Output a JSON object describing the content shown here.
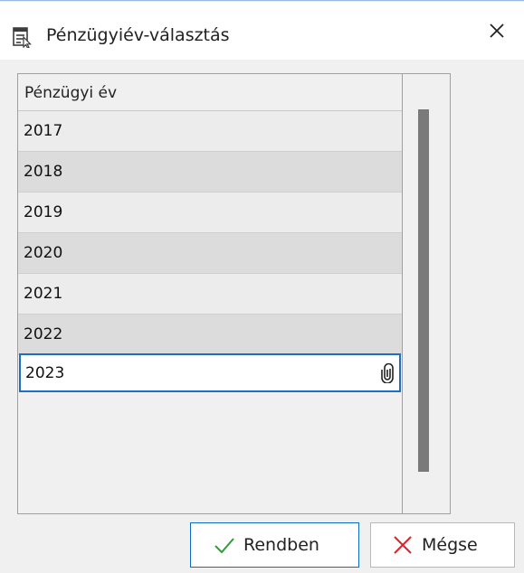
{
  "window": {
    "title": "Pénzügyiév-választás",
    "close_symbol": "×"
  },
  "grid": {
    "column_header": "Pénzügyi év",
    "rows": [
      "2017",
      "2018",
      "2019",
      "2020",
      "2021",
      "2022",
      "2023"
    ],
    "selected_index": 6,
    "selected_row_icon": "paperclip-icon"
  },
  "buttons": {
    "ok_label": "Rendben",
    "ok_icon": "checkmark-icon",
    "cancel_label": "Mégse",
    "cancel_icon": "x-icon"
  },
  "colors": {
    "accent": "#1b6fc7",
    "ok_check": "#2e9e3e",
    "cancel_x": "#d9262d"
  }
}
